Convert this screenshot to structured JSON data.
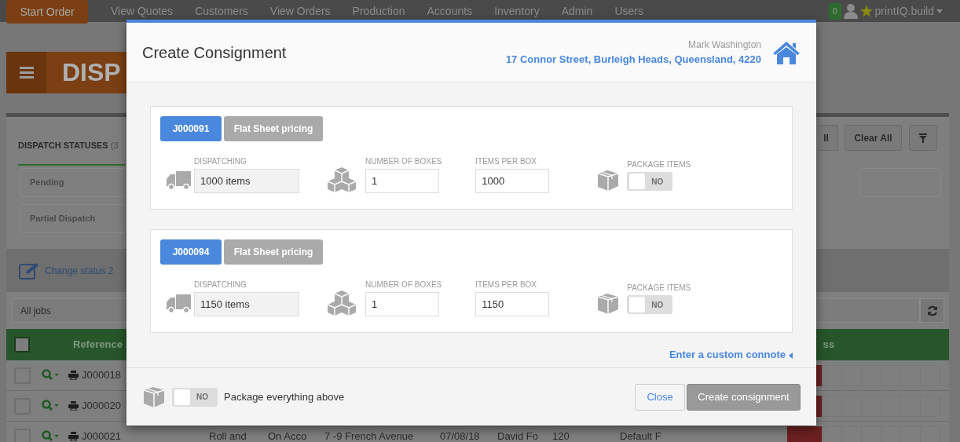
{
  "navbar": {
    "start_button": "Start Order",
    "items": [
      "View Quotes",
      "Customers",
      "View Orders",
      "Production",
      "Accounts",
      "Inventory",
      "Admin",
      "Users"
    ],
    "badge": "0",
    "account": "printIQ.build"
  },
  "page_header": {
    "title": "DISP"
  },
  "statuses": {
    "tab": "DISPATCH STATUSES",
    "count": "(3",
    "buttons": [
      "ll",
      "Clear All"
    ],
    "items": [
      "Pending",
      "Partial Dispatch"
    ]
  },
  "change_status": "Change status 2",
  "filter": {
    "value": "All jobs"
  },
  "table": {
    "select_all_checked": false,
    "columns": [
      "Reference",
      "ss"
    ],
    "rows": [
      {
        "checked": false,
        "reference": "J000018"
      },
      {
        "checked": false,
        "reference": "J000020"
      },
      {
        "checked": false,
        "reference": "J000021",
        "cells": [
          "Roll and",
          "On Acco",
          "7 -9 French Avenue",
          "07/08/18",
          "David Fo",
          "120",
          "Default F"
        ]
      }
    ]
  },
  "modal": {
    "title": "Create Consignment",
    "customer": "Mark Washington",
    "address": "17 Connor Street, Burleigh Heads, Queensland, 4220",
    "jobs": [
      {
        "job": "J000091",
        "pricing": "Flat Sheet pricing",
        "dispatching_label": "DISPATCHING",
        "dispatching": "1000 items",
        "boxes_label": "NUMBER OF BOXES",
        "boxes": "1",
        "per_box_label": "ITEMS PER BOX",
        "per_box": "1000",
        "package_label": "PACKAGE ITEMS",
        "package": {
          "on": false,
          "label": "NO"
        }
      },
      {
        "job": "J000094",
        "pricing": "Flat Sheet pricing",
        "dispatching_label": "DISPATCHING",
        "dispatching": "1150 items",
        "boxes_label": "NUMBER OF BOXES",
        "boxes": "1",
        "per_box_label": "ITEMS PER BOX",
        "per_box": "1150",
        "package_label": "PACKAGE ITEMS",
        "package": {
          "on": false,
          "label": "NO"
        }
      }
    ],
    "custom_connote": "Enter a custom connote",
    "package_all": {
      "on": false,
      "label": "NO"
    },
    "package_all_text": "Package everything above",
    "close_button": "Close",
    "create_button": "Create consignment"
  }
}
